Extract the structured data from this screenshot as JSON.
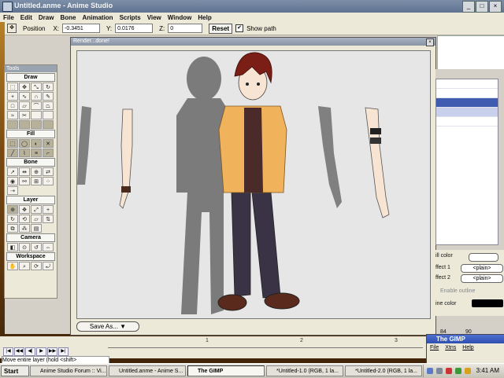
{
  "window": {
    "title": "Untitled.anme - Anime Studio",
    "min": "_",
    "max": "□",
    "close": "×"
  },
  "menu": [
    "File",
    "Edit",
    "Draw",
    "Bone",
    "Animation",
    "Scripts",
    "View",
    "Window",
    "Help"
  ],
  "options": {
    "position_label": "Position",
    "x_label": "X:",
    "x_value": "-0.3451",
    "y_label": "Y:",
    "y_value": "0.0176",
    "z_label": "Z:",
    "z_value": "0",
    "reset_label": "Reset",
    "show_path_label": "Show path",
    "show_path_checked": "✔"
  },
  "tools": {
    "title": "Tools",
    "sections": [
      "Draw",
      "Fill",
      "Bone",
      "Layer",
      "Camera",
      "Workspace"
    ]
  },
  "render": {
    "title": "Render...done!",
    "close": "×",
    "save_as_label": "Save As...   ▼"
  },
  "settings": {
    "fill_color_label": "ill color",
    "effect1_label": "ffect 1",
    "effect1_value": "<plain>",
    "effect2_label": "ffect 2",
    "effect2_value": "<plain>",
    "enable_outline_label": "Enable outline",
    "line_color_label": "ine color",
    "value_a": "84",
    "value_b": "90"
  },
  "gimp": {
    "title": "The GIMP",
    "menu": [
      "File",
      "Xtns",
      "Help"
    ]
  },
  "timeline": {
    "ticks": [
      "1",
      "2",
      "3"
    ],
    "status": "Move entire layer (hold <shift>"
  },
  "taskbar": {
    "start": "Start",
    "tasks": [
      "Anime Studio Forum :: Vi...",
      "Untitled.anme - Anime S...",
      "The GIMP",
      "*Untitled-1.0 (RGB, 1 la...",
      "*Untitled-2.0 (RGB, 1 la..."
    ],
    "clock": "3:41 AM"
  },
  "colors": {
    "accent": "#3f5cb0",
    "hair": "#7a1e16",
    "jacket": "#f0b25a",
    "pants": "#3a3346",
    "shadow": "#7a7a7a",
    "skin": "#f7e4d2"
  }
}
